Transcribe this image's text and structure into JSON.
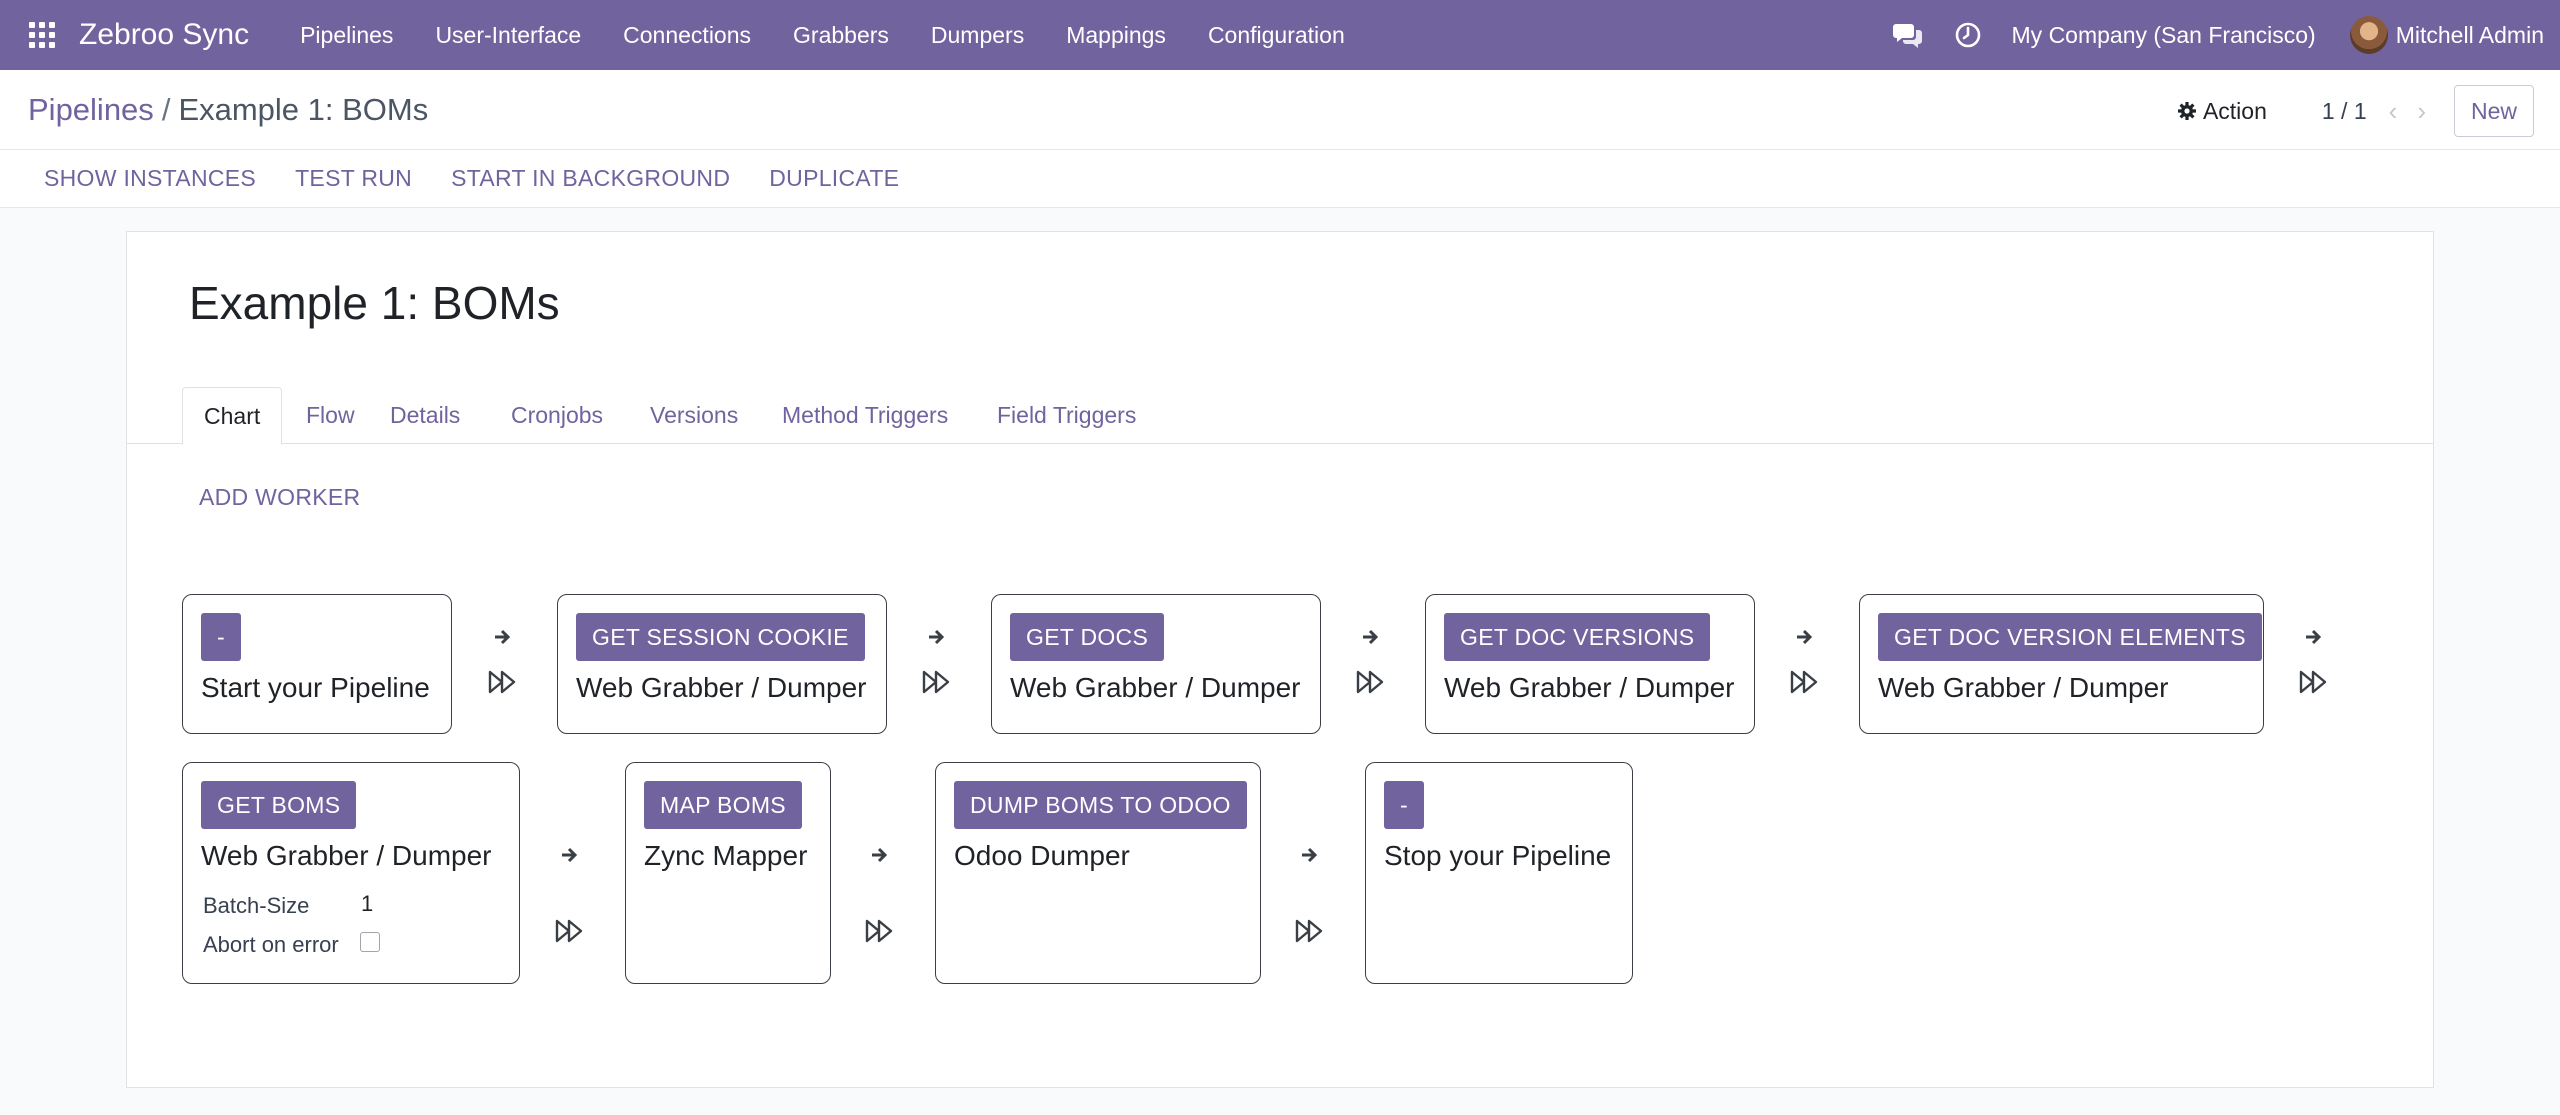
{
  "navbar": {
    "brand": "Zebroo Sync",
    "menu": [
      {
        "label": "Pipelines"
      },
      {
        "label": "User-Interface"
      },
      {
        "label": "Connections"
      },
      {
        "label": "Grabbers"
      },
      {
        "label": "Dumpers"
      },
      {
        "label": "Mappings"
      },
      {
        "label": "Configuration"
      }
    ],
    "company": "My Company (San Francisco)",
    "user": "Mitchell Admin",
    "icons": [
      "apps-icon",
      "chat-icon",
      "clock-icon",
      "avatar"
    ]
  },
  "control_panel": {
    "breadcrumb_parent": "Pipelines",
    "breadcrumb_separator": "/",
    "breadcrumb_current": "Example 1: BOMs",
    "action_label": "Action",
    "pager": "1 / 1",
    "new_label": "New"
  },
  "button_bar": {
    "show_instances": "SHOW INSTANCES",
    "test_run": "TEST RUN",
    "start_in_background": "START IN BACKGROUND",
    "duplicate": "DUPLICATE"
  },
  "record": {
    "title": "Example 1: BOMs"
  },
  "tabs": [
    {
      "label": "Chart",
      "active": true
    },
    {
      "label": "Flow"
    },
    {
      "label": "Details"
    },
    {
      "label": "Cronjobs"
    },
    {
      "label": "Versions"
    },
    {
      "label": "Method Triggers"
    },
    {
      "label": "Field Triggers"
    }
  ],
  "chart": {
    "add_worker": "ADD WORKER",
    "workers": [
      {
        "tag": "-",
        "type": "Start your Pipeline"
      },
      {
        "tag": "GET SESSION COOKIE",
        "type": "Web Grabber / Dumper"
      },
      {
        "tag": "GET DOCS",
        "type": "Web Grabber / Dumper"
      },
      {
        "tag": "GET DOC VERSIONS",
        "type": "Web Grabber / Dumper"
      },
      {
        "tag": "GET DOC VERSION ELEMENTS",
        "type": "Web Grabber / Dumper"
      },
      {
        "tag": "GET BOMS",
        "type": "Web Grabber / Dumper",
        "batch_size_label": "Batch-Size",
        "batch_size_value": "1",
        "abort_label": "Abort on error",
        "abort_on_error": false
      },
      {
        "tag": "MAP BOMS",
        "type": "Zync Mapper"
      },
      {
        "tag": "DUMP BOMS TO ODOO",
        "type": "Odoo Dumper"
      },
      {
        "tag": "-",
        "type": "Stop your Pipeline"
      }
    ]
  },
  "colors": {
    "brand": "#71639e",
    "navbar_text": "#ffffff",
    "border": "#3a3f45"
  }
}
